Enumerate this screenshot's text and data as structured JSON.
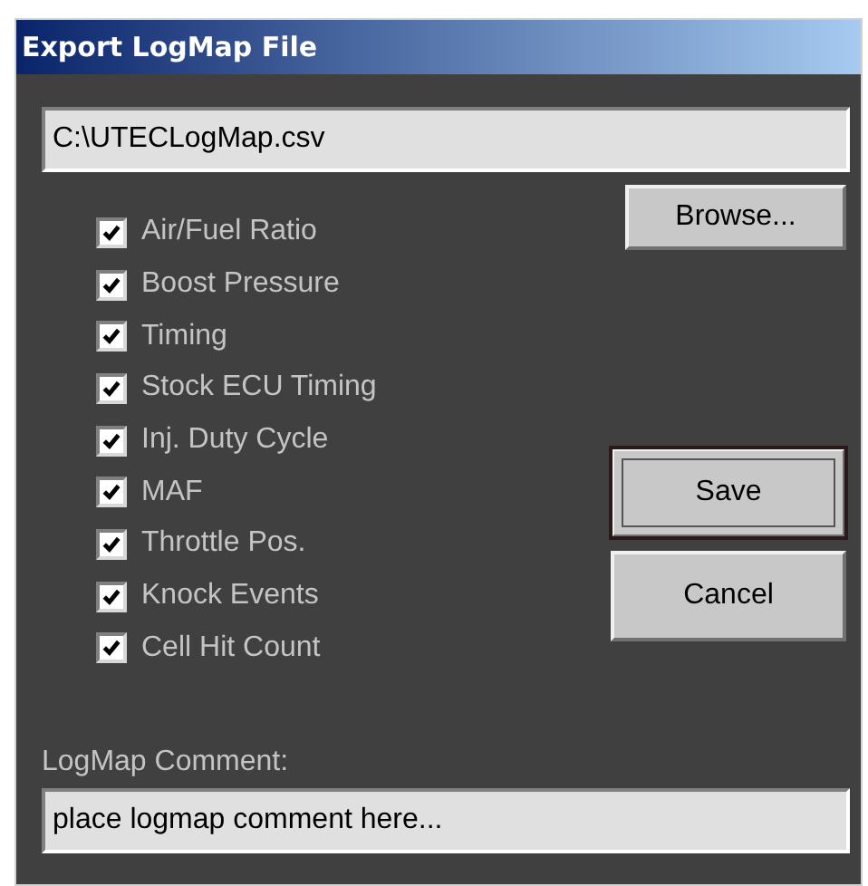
{
  "window": {
    "title": "Export LogMap File"
  },
  "file_path": {
    "value": "C:\\UTECLogMap.csv"
  },
  "browse_button": {
    "label": "Browse..."
  },
  "options": [
    {
      "label": "Air/Fuel Ratio",
      "checked": true
    },
    {
      "label": "Boost Pressure",
      "checked": true
    },
    {
      "label": "Timing",
      "checked": true
    },
    {
      "label": "Stock ECU Timing",
      "checked": true
    },
    {
      "label": "Inj. Duty Cycle",
      "checked": true
    },
    {
      "label": "MAF",
      "checked": true
    },
    {
      "label": "Throttle Pos.",
      "checked": true
    },
    {
      "label": "Knock Events",
      "checked": true
    },
    {
      "label": "Cell Hit Count",
      "checked": true
    }
  ],
  "actions": [
    {
      "label": "Save",
      "focused": true
    },
    {
      "label": "Cancel",
      "focused": false
    }
  ],
  "comment": {
    "label": "LogMap Comment:",
    "value": "place logmap comment here..."
  }
}
